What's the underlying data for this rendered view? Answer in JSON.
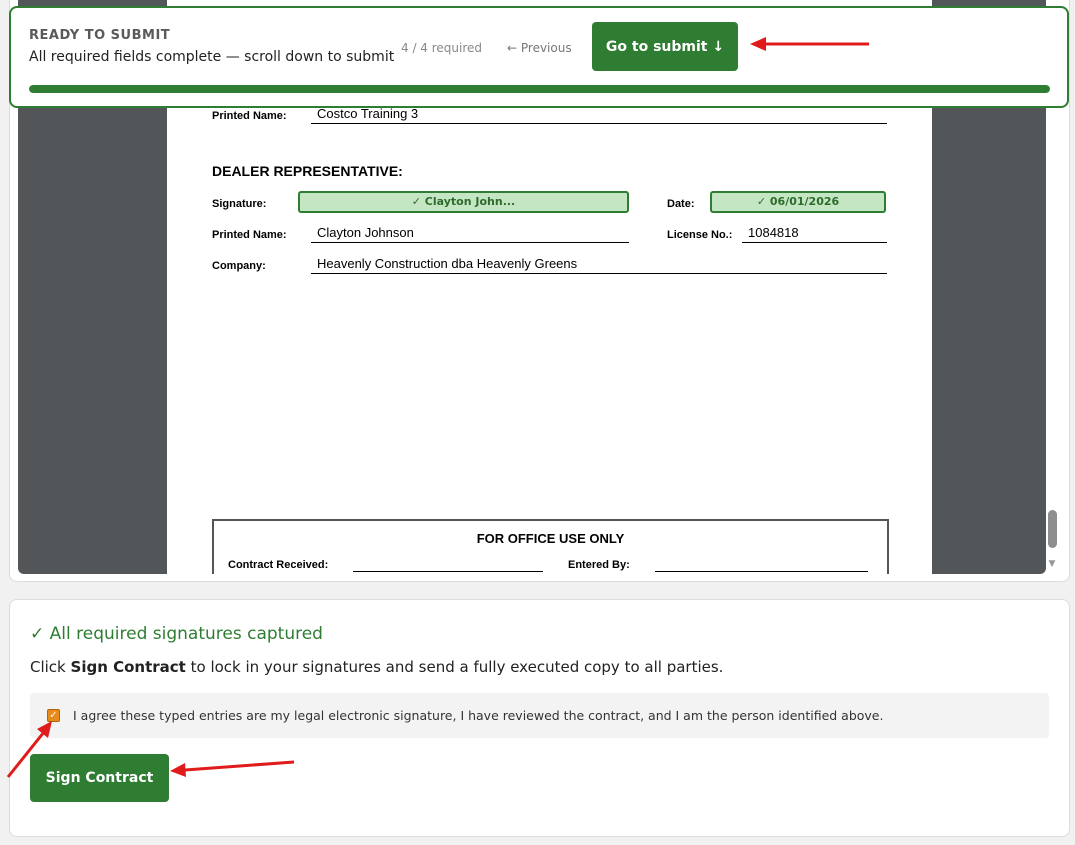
{
  "banner": {
    "kicker": "READY TO SUBMIT",
    "message": "All required fields complete — scroll down to submit",
    "count": "4 / 4 required",
    "previous": "← Previous",
    "go_to_submit": "Go to submit ↓",
    "progress_fraction": 1.0
  },
  "document": {
    "customer_printed_name_label": "Printed Name:",
    "customer_printed_name": "Costco Training 3",
    "dealer_heading": "DEALER REPRESENTATIVE:",
    "signature_label": "Signature:",
    "signature_value": "✓ Clayton John...",
    "date_label": "Date:",
    "date_value": "✓ 06/01/2026",
    "printed_name_label": "Printed Name:",
    "printed_name": "Clayton Johnson",
    "license_label": "License No.:",
    "license_value": "1084818",
    "company_label": "Company:",
    "company_value": "Heavenly Construction dba Heavenly Greens",
    "office_title": "FOR OFFICE USE ONLY",
    "contract_received_label": "Contract Received:",
    "entered_by_label": "Entered By:"
  },
  "submit": {
    "captured": "✓ All required signatures captured",
    "instr_prefix": "Click ",
    "instr_bold": "Sign Contract",
    "instr_suffix": " to lock in your signatures and send a fully executed copy to all parties.",
    "agree_text": "I agree these typed entries are my legal electronic signature, I have reviewed the contract, and I am the person identified above.",
    "agree_checked": true,
    "sign_button": "Sign Contract"
  },
  "colors": {
    "accent": "#2e7d32",
    "signed_fill": "#c4e6c2",
    "checkbox": "#e98a1c",
    "annotation": "#e01b1b"
  }
}
